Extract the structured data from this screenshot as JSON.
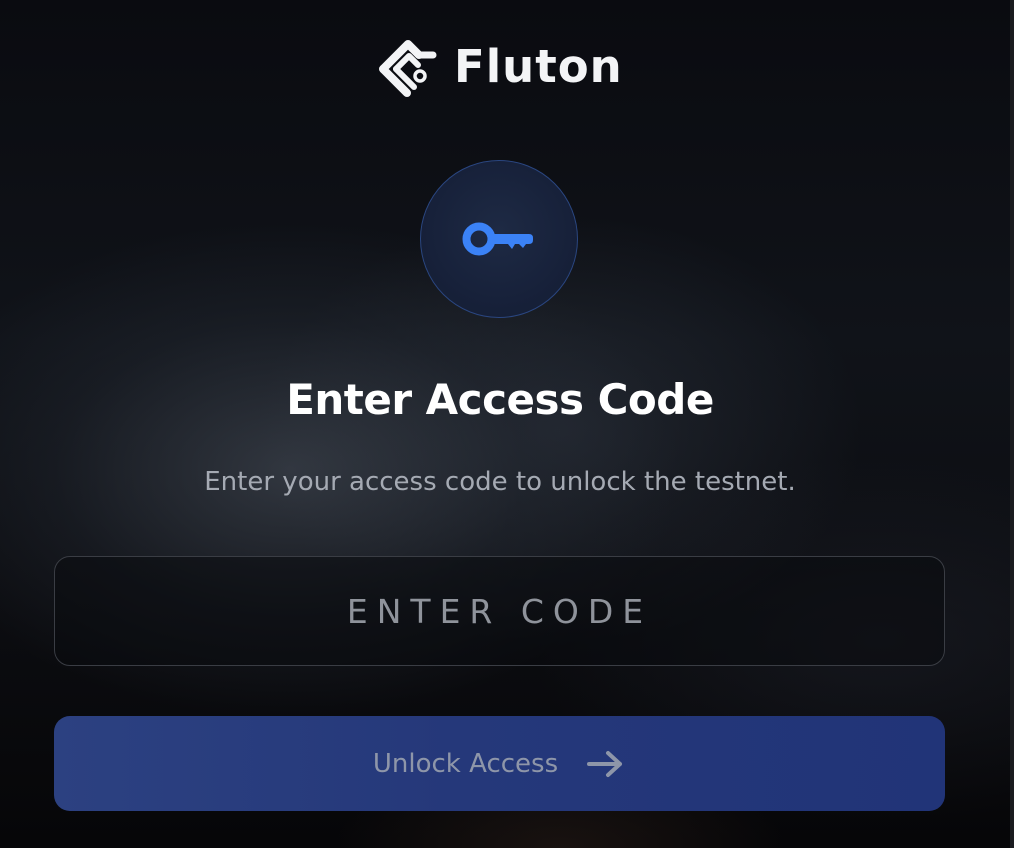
{
  "brand": {
    "name": "Fluton"
  },
  "access": {
    "title": "Enter Access Code",
    "subtitle": "Enter your access code to unlock the testnet.",
    "input_placeholder": "ENTER CODE",
    "input_value": "",
    "button_label": "Unlock Access"
  },
  "icons": {
    "logo": "fluton-logo-icon",
    "key": "key-icon",
    "arrow": "arrow-right-icon"
  },
  "colors": {
    "accent": "#3b82f6",
    "button": "#273a7c",
    "background": "#0c0e13"
  }
}
